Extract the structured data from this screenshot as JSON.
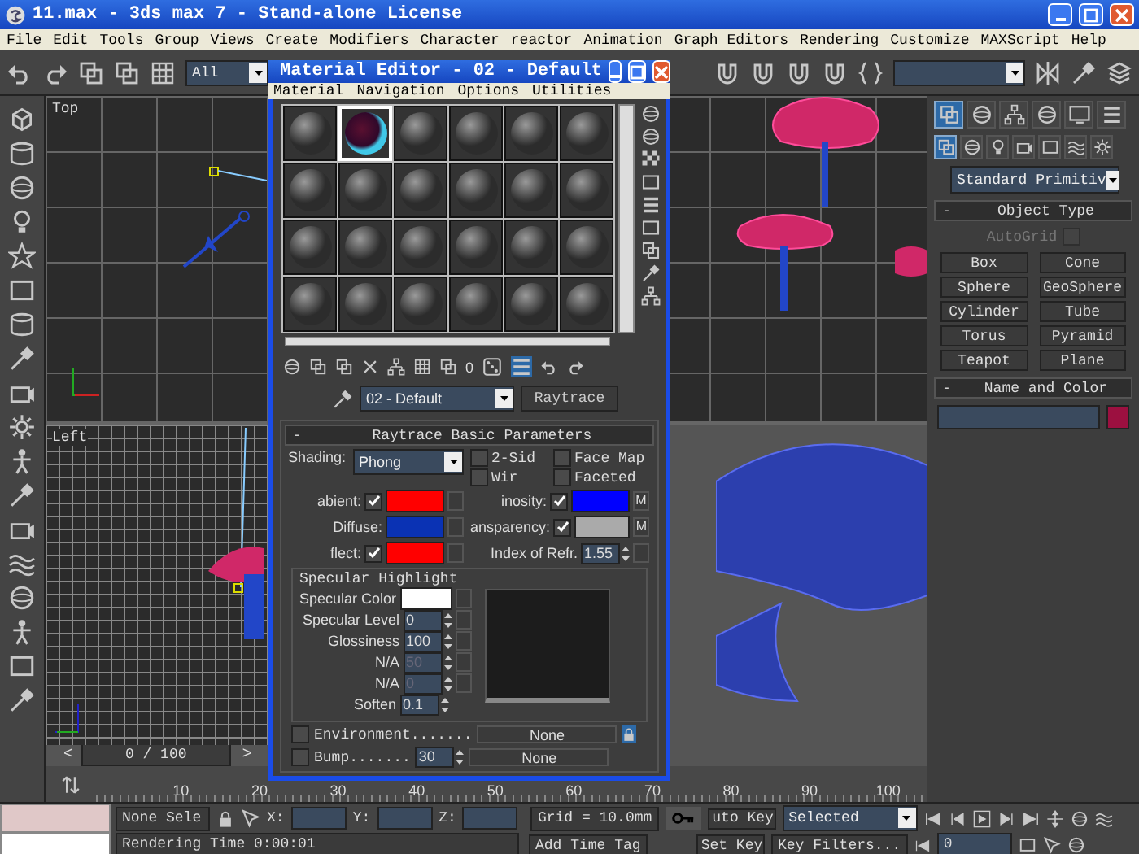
{
  "window": {
    "title": "11.max - 3ds max 7  - Stand-alone License"
  },
  "menu": [
    "File",
    "Edit",
    "Tools",
    "Group",
    "Views",
    "Create",
    "Modifiers",
    "Character",
    "reactor",
    "Animation",
    "Graph Editors",
    "Rendering",
    "Customize",
    "MAXScript",
    "Help"
  ],
  "toolbar": {
    "selection_filter": "All"
  },
  "viewports": {
    "top_left": {
      "label": "Top"
    },
    "bottom_left": {
      "label": "Left"
    }
  },
  "time_slider": {
    "prev": "<",
    "position": "0 / 100",
    "next": ">",
    "level": 0
  },
  "ruler": {
    "ticks": [
      "10",
      "20",
      "30",
      "40",
      "50",
      "60",
      "70",
      "80",
      "90",
      "100"
    ]
  },
  "status": {
    "selection": "None Sele",
    "x_label": "X:",
    "y_label": "Y:",
    "z_label": "Z:",
    "grid": "Grid = 10.0mm",
    "prompt": "Rendering Time  0:00:01",
    "time_tag": "Add Time Tag",
    "auto_key": "uto Key",
    "key_mode": "Selected",
    "set_key": "Set Key",
    "key_filters": "Key Filters...",
    "frame": "0"
  },
  "command_panel": {
    "tabs": [
      {
        "selected": true
      },
      {
        "selected": false
      },
      {
        "selected": false
      },
      {
        "selected": false
      },
      {
        "selected": false
      },
      {
        "selected": false
      }
    ],
    "subtabs": [
      {
        "selected": true
      },
      {
        "selected": false
      },
      {
        "selected": false
      },
      {
        "selected": false
      },
      {
        "selected": false
      },
      {
        "selected": false
      },
      {
        "selected": false
      }
    ],
    "category": "Standard Primitiv",
    "object_type": {
      "toggle": "-",
      "title": "Object Type",
      "autogrid": {
        "label": "AutoGrid",
        "checked": false,
        "disabled": true
      },
      "buttons": [
        "Box",
        "Cone",
        "Sphere",
        "GeoSphere",
        "Cylinder",
        "Tube",
        "Torus",
        "Pyramid",
        "Teapot",
        "Plane"
      ]
    },
    "name_and_color": {
      "toggle": "-",
      "title": "Name and Color",
      "color": "#9c1040"
    }
  },
  "material_editor": {
    "title": "Material Editor - 02 - Default",
    "menu": [
      "Material",
      "Navigation",
      "Options",
      "Utilities"
    ],
    "slots": [
      {
        "selected": false
      },
      {
        "selected": true
      },
      {
        "selected": false
      },
      {
        "selected": false
      },
      {
        "selected": false
      },
      {
        "selected": false
      },
      {
        "selected": false
      },
      {
        "selected": false
      },
      {
        "selected": false
      },
      {
        "selected": false
      },
      {
        "selected": false
      },
      {
        "selected": false
      },
      {
        "selected": false
      },
      {
        "selected": false
      },
      {
        "selected": false
      },
      {
        "selected": false
      },
      {
        "selected": false
      },
      {
        "selected": false
      },
      {
        "selected": false
      },
      {
        "selected": false
      },
      {
        "selected": false
      },
      {
        "selected": false
      },
      {
        "selected": false
      },
      {
        "selected": false
      }
    ],
    "sample_text": "0",
    "material_name": "02 - Default",
    "material_type": "Raytrace",
    "rollout": {
      "toggle": "-",
      "title": "Raytrace Basic Parameters",
      "shading_label": "Shading:",
      "shading": "Phong",
      "options": [
        {
          "label": "2-Sid",
          "checked": false
        },
        {
          "label": "Face Map",
          "checked": false
        },
        {
          "label": "Wir",
          "checked": false
        },
        {
          "label": "Faceted",
          "checked": false
        }
      ],
      "params": [
        {
          "kind": "color",
          "label": "abient:",
          "checked": true,
          "color": "#ff0000"
        },
        {
          "kind": "color",
          "label": "inosity:",
          "checked": true,
          "color": "#0000ff",
          "map": "M"
        },
        {
          "kind": "color",
          "label": "Diffuse:",
          "color": "#0a32b4"
        },
        {
          "kind": "color",
          "label": "ansparency:",
          "checked": true,
          "color": "#aaaaaa",
          "map": "M"
        },
        {
          "kind": "color",
          "label": "flect:",
          "checked": true,
          "color": "#ff0000"
        },
        {
          "kind": "spinner",
          "label": "Index of Refr.",
          "value": "1.55"
        }
      ],
      "specular": {
        "title": "Specular Highlight",
        "rows": [
          {
            "kind": "color",
            "label": "Specular Color",
            "color": "#ffffff"
          },
          {
            "kind": "spinner",
            "label": "Specular Level",
            "value": "0",
            "disabled": false
          },
          {
            "kind": "spinner",
            "label": "Glossiness",
            "value": "100",
            "disabled": false
          },
          {
            "kind": "spinner",
            "label": "N/A",
            "value": "50",
            "disabled": true
          },
          {
            "kind": "spinner",
            "label": "N/A",
            "value": "0",
            "disabled": true
          },
          {
            "kind": "spinner",
            "label": "Soften",
            "value": "0.1",
            "disabled": false,
            "nomap": true
          }
        ]
      },
      "maps": [
        {
          "label": "Environment.......",
          "checked": false,
          "map": "None"
        },
        {
          "label": "Bump.......",
          "checked": false,
          "amount": "30",
          "map": "None"
        }
      ]
    }
  }
}
